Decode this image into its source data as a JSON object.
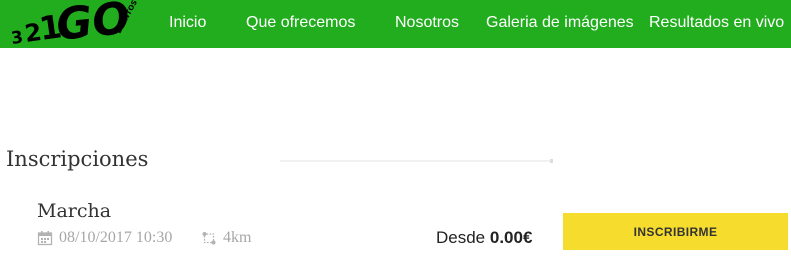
{
  "brand": {
    "logo_text": "321GO",
    "logo_sub": "EVENTOS",
    "colors": {
      "nav_bg": "#22ad1f",
      "button_bg": "#f6dc2d"
    }
  },
  "nav": {
    "items": [
      {
        "label": "Inicio"
      },
      {
        "label": "Que ofrecemos"
      },
      {
        "label": "Nosotros"
      },
      {
        "label": "Galeria de imágenes"
      },
      {
        "label": "Resultados en vivo"
      }
    ]
  },
  "section": {
    "title": "Inscripciones"
  },
  "event": {
    "name": "Marcha",
    "date": "08/10/2017 10:30",
    "distance": "4km",
    "price_prefix": "Desde",
    "price": "0.00€",
    "button_label": "INSCRIBIRME",
    "icons": {
      "date": "calendar-icon",
      "distance": "route-icon"
    }
  }
}
